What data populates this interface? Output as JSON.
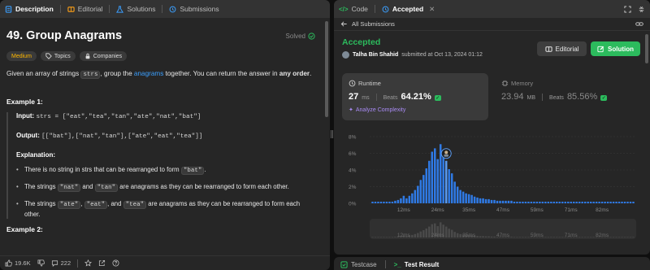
{
  "left_tabs": {
    "description": "Description",
    "editorial": "Editorial",
    "solutions": "Solutions",
    "submissions": "Submissions"
  },
  "problem": {
    "title": "49. Group Anagrams",
    "solved": "Solved",
    "tags": {
      "difficulty": "Medium",
      "topics": "Topics",
      "companies": "Companies"
    },
    "desc_1": "Given an array of strings ",
    "desc_code": "strs",
    "desc_2": ", group the ",
    "desc_link": "anagrams",
    "desc_3": " together. You can return the answer in ",
    "desc_bold": "any order",
    "desc_4": "."
  },
  "example1": {
    "title": "Example 1:",
    "input_label": "Input:",
    "input_value": "strs = [\"eat\",\"tea\",\"tan\",\"ate\",\"nat\",\"bat\"]",
    "output_label": "Output:",
    "output_value": "[[\"bat\"],[\"nat\",\"tan\"],[\"ate\",\"eat\",\"tea\"]]",
    "explanation_label": "Explanation:",
    "b1_pre": "There is no string in strs that can be rearranged to form ",
    "b1_code": "\"bat\"",
    "b1_post": ".",
    "b2_pre": "The strings ",
    "b2_code1": "\"nat\"",
    "b2_mid": " and ",
    "b2_code2": "\"tan\"",
    "b2_post": " are anagrams as they can be rearranged to form each other.",
    "b3_pre": "The strings ",
    "b3_code1": "\"ate\"",
    "b3_sep1": ", ",
    "b3_code2": "\"eat\"",
    "b3_sep2": ", and ",
    "b3_code3": "\"tea\"",
    "b3_post": " are anagrams as they can be rearranged to form each other."
  },
  "example2": {
    "title": "Example 2:"
  },
  "footer": {
    "likes": "19.6K",
    "comments": "222"
  },
  "right_tabs": {
    "code": "Code",
    "accepted": "Accepted"
  },
  "all_submissions": "All Submissions",
  "result": {
    "status": "Accepted",
    "user": "Talha Bin Shahid",
    "submitted_at": "submitted at Oct 13, 2024 01:12",
    "editorial_btn": "Editorial",
    "solution_btn": "Solution"
  },
  "runtime": {
    "label": "Runtime",
    "value": "27",
    "unit": "ms",
    "beats_label": "Beats",
    "beats_value": "64.21%",
    "analyze": "Analyze Complexity"
  },
  "memory": {
    "label": "Memory",
    "value": "23.94",
    "unit": "MB",
    "beats_label": "Beats",
    "beats_value": "85.56%"
  },
  "bottom_tabs": {
    "testcase": "Testcase",
    "test_result": "Test Result"
  },
  "colors": {
    "accent_green": "#2cbb5d",
    "bar_blue": "#2f7ae5",
    "bar_grey": "#4a4a4a",
    "medium_yellow": "#ffb800",
    "link_blue": "#3b9ffe"
  },
  "chart_data": {
    "type": "bar",
    "y_ticks": [
      "8%",
      "6%",
      "4%",
      "2%",
      "0%"
    ],
    "ylim": [
      0,
      8
    ],
    "x_ticks": [
      "12ms",
      "24ms",
      "35ms",
      "47ms",
      "59ms",
      "71ms",
      "82ms"
    ],
    "xlim": [
      0,
      94
    ],
    "bar_step_ms": 1,
    "bar_start_ms": 1,
    "values": [
      0.2,
      0.2,
      0.2,
      0.2,
      0.2,
      0.2,
      0.2,
      0.2,
      0.3,
      0.4,
      0.6,
      0.9,
      0.6,
      0.9,
      1.2,
      1.6,
      2.1,
      2.8,
      3.4,
      4.2,
      5.1,
      6.2,
      6.6,
      5.3,
      7.1,
      6.0,
      5.1,
      4.1,
      3.6,
      2.6,
      2.0,
      1.6,
      1.4,
      1.2,
      1.1,
      1.0,
      0.8,
      0.7,
      0.6,
      0.6,
      0.5,
      0.5,
      0.4,
      0.4,
      0.3,
      0.3,
      0.3,
      0.3,
      0.3,
      0.3,
      0.2,
      0.2,
      0.2,
      0.2,
      0.2,
      0.2,
      0.2,
      0.2,
      0.2,
      0.2,
      0.2,
      0.2,
      0.2,
      0.2,
      0.2,
      0.2,
      0.2,
      0.2,
      0.2,
      0.2,
      0.2,
      0.2,
      0.2,
      0.2,
      0.2,
      0.2,
      0.2,
      0.2,
      0.2,
      0.2,
      0.2,
      0.2,
      0.2,
      0.2,
      0.2,
      0.2,
      0.2,
      0.2,
      0.2,
      0.2,
      0.2,
      0.2,
      0.2
    ],
    "user_marker_ms": 27,
    "grid": true
  }
}
